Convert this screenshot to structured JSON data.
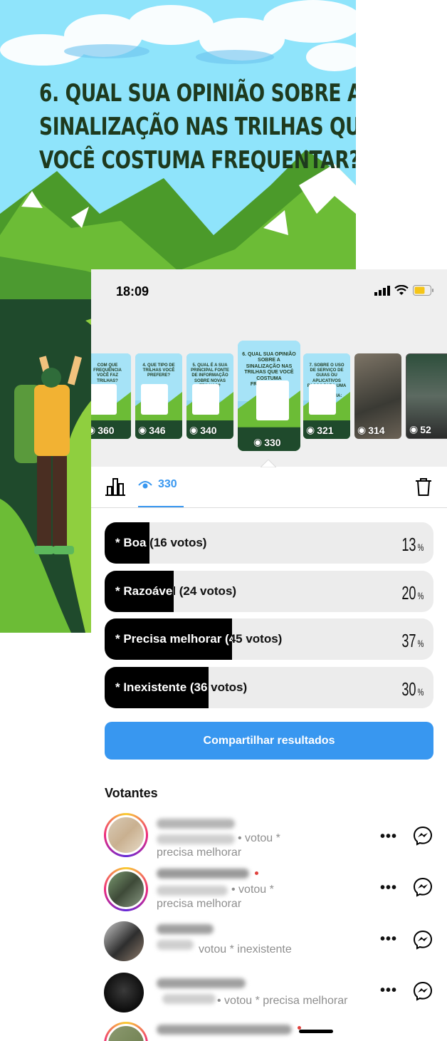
{
  "poster": {
    "title_lines": [
      "6. QUAL SUA OPINIÃO SOBRE A",
      "SINALIZAÇÃO NAS TRILHAS QUE",
      "VOCÊ COSTUMA FREQUENTAR?"
    ]
  },
  "status_bar": {
    "time": "18:09"
  },
  "story_strip": {
    "thumbnails": [
      {
        "question": "COM QUE FREQUÊNCIA VOCÊ FAZ TRILHAS?",
        "views": "360"
      },
      {
        "question": "4. QUE TIPO DE TRILHAS VOCÊ PREFERE?",
        "views": "346"
      },
      {
        "question": "5. QUAL É A SUA PRINCIPAL FONTE DE INFORMAÇÃO SOBRE NOVAS TRILHAS?",
        "views": "340"
      },
      {
        "question": "6. QUAL SUA OPINIÃO SOBRE A SINALIZAÇÃO NAS TRILHAS QUE VOCÊ COSTUMA FREQUENTAR?",
        "views": "330"
      },
      {
        "question": "7. SOBRE O USO DE SERVIÇO DE GUIAS OU APLICATIVOS PAGOS PARA UMA MELHOR EXPERIÊNCIA:",
        "views": "321"
      },
      {
        "question": "",
        "views": "314"
      },
      {
        "question": "",
        "views": "52"
      }
    ]
  },
  "tabs": {
    "views_count": "330"
  },
  "poll": {
    "options": [
      {
        "label": "* Boa (16 votos)",
        "percent": 13,
        "percent_text": "13"
      },
      {
        "label": "* Razoável (24 votos)",
        "percent": 20,
        "percent_text": "20"
      },
      {
        "label": "* Precisa melhorar (45 votos)",
        "percent": 37,
        "percent_text": "37"
      },
      {
        "label": "* Inexistente (36 votos)",
        "percent": 30,
        "percent_text": "30"
      }
    ],
    "percent_symbol": "%",
    "share_label": "Compartilhar resultados"
  },
  "voters": {
    "title": "Votantes",
    "items": [
      {
        "vote_text": "• votou *",
        "vote_line2": "precisa melhorar"
      },
      {
        "vote_text": "• votou *",
        "vote_line2": "precisa melhorar"
      },
      {
        "vote_text": "votou * inexistente",
        "vote_line2": ""
      },
      {
        "vote_text": "• votou * precisa melhorar",
        "vote_line2": ""
      }
    ],
    "more_label": "•••"
  },
  "colors": {
    "accent": "#3897f0",
    "sky": "#8fe4fb",
    "mountain": "#5fb02f",
    "dark_green": "#1f4a2c"
  }
}
